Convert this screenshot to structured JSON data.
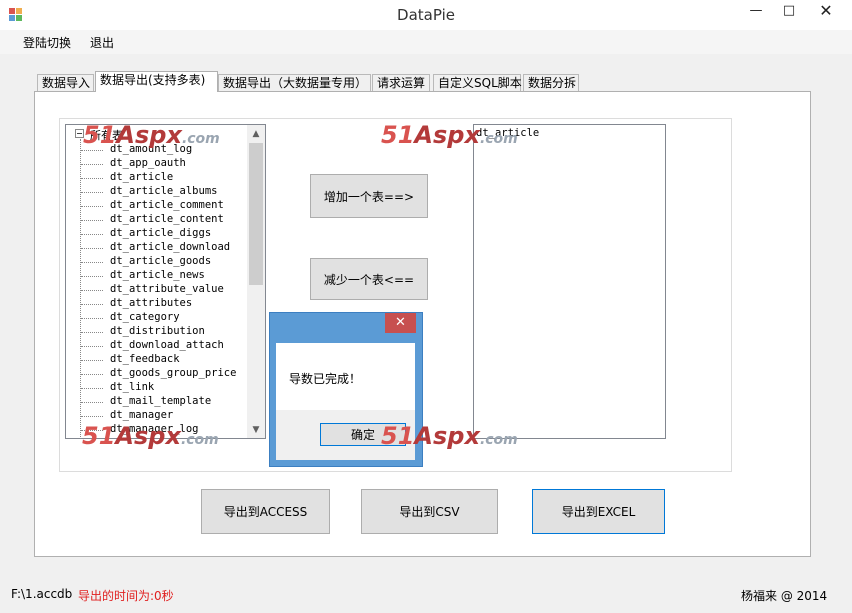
{
  "window": {
    "title": "DataPie"
  },
  "menu": {
    "items": [
      "登陆切换",
      "退出"
    ]
  },
  "tabs": [
    "数据导入",
    "数据导出(支持多表)",
    "数据导出（大数据量专用）",
    "请求运算",
    "自定义SQL脚本",
    "数据分拆"
  ],
  "active_tab": 1,
  "tree": {
    "root": "所有表",
    "items": [
      "dt_amount_log",
      "dt_app_oauth",
      "dt_article",
      "dt_article_albums",
      "dt_article_comment",
      "dt_article_content",
      "dt_article_diggs",
      "dt_article_download",
      "dt_article_goods",
      "dt_article_news",
      "dt_attribute_value",
      "dt_attributes",
      "dt_category",
      "dt_distribution",
      "dt_download_attach",
      "dt_feedback",
      "dt_goods_group_price",
      "dt_link",
      "dt_mail_template",
      "dt_manager",
      "dt_manager_log"
    ]
  },
  "selected_list": {
    "items": [
      "dt_article"
    ]
  },
  "buttons": {
    "add": "增加一个表==>",
    "remove": "减少一个表<==",
    "export_access": "导出到ACCESS",
    "export_csv": "导出到CSV",
    "export_excel": "导出到EXCEL"
  },
  "dialog": {
    "message": "导数已完成！",
    "ok": "确定"
  },
  "watermark": {
    "num": "51",
    "brand": "Aspx",
    "suffix": ".com"
  },
  "status": {
    "file": "F:\\1.accdb",
    "time_text": "导出的时间为:0秒",
    "author": "杨福来 @ 2014",
    "time_color": "#e02020"
  }
}
